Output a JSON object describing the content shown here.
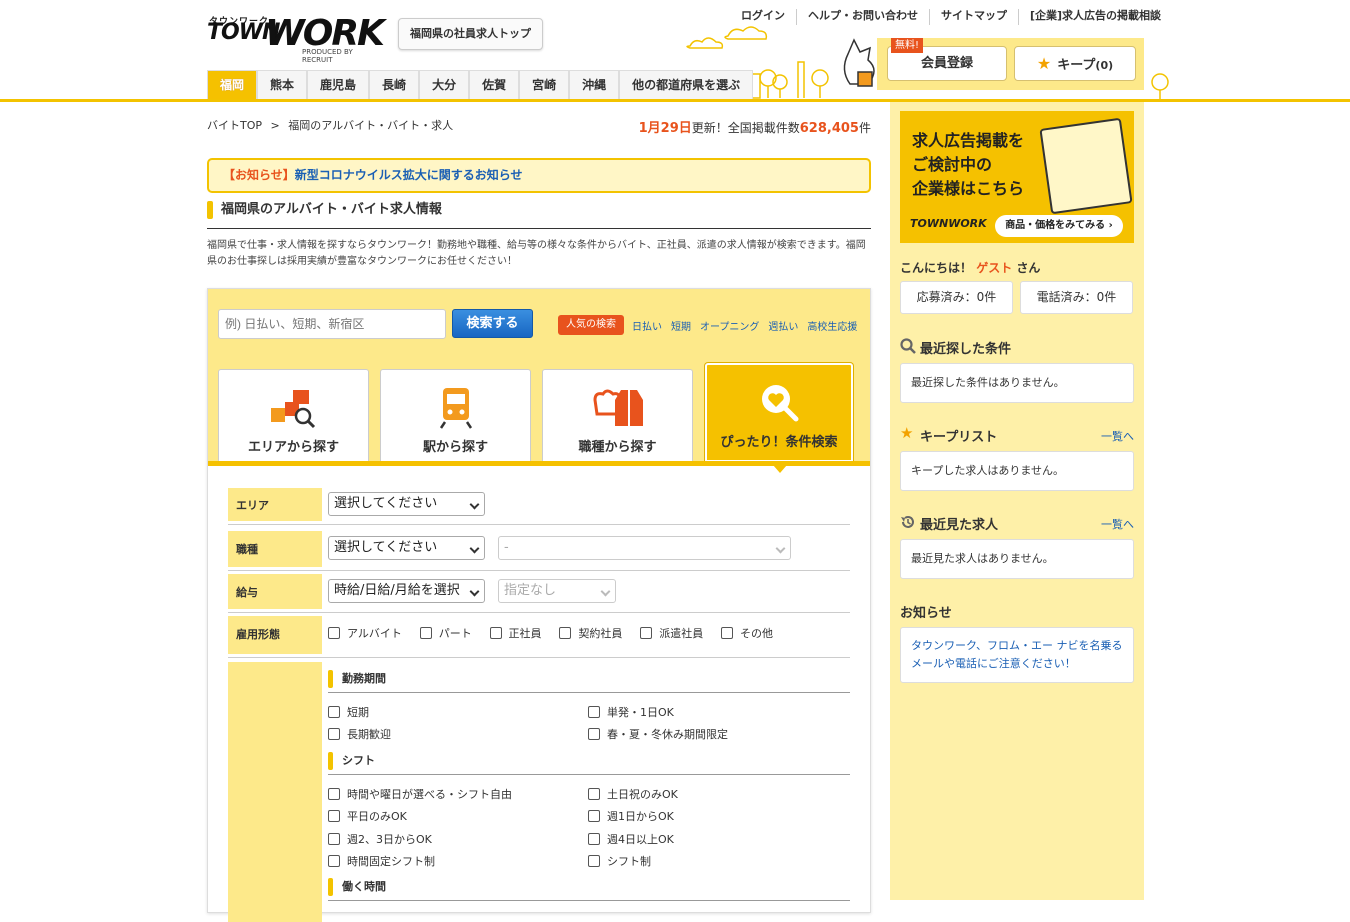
{
  "header": {
    "logo_kana": "タウンワーク",
    "logo_town": "TOWN",
    "logo_work": "WORK",
    "logo_produced": "PRODUCED BY RECRUIT",
    "top_button": "福岡県の社員求人トップ",
    "util_links": [
      "ログイン",
      "ヘルプ・お問い合わせ",
      "サイトマップ",
      "[企業]求人広告の掲載相談"
    ],
    "free_badge": "無料!",
    "register_label": "会員登録",
    "keep_label": "キープ",
    "keep_count": "(0)",
    "nav_tabs": [
      "福岡",
      "熊本",
      "鹿児島",
      "長崎",
      "大分",
      "佐賀",
      "宮崎",
      "沖縄",
      "他の都道府県を選ぶ"
    ]
  },
  "main": {
    "breadcrumb_top": "バイトTOP",
    "breadcrumb_sep": ">",
    "breadcrumb_current": "福岡のアルバイト・バイト・求人",
    "update_date": "1月29日",
    "update_text1": "更新！全国掲載件数",
    "update_count": "628,405",
    "update_unit": "件",
    "notice_label": "【お知らせ】",
    "notice_link": "新型コロナウイルス拡大に関するお知らせ",
    "section_title": "福岡県のアルバイト・バイト求人情報",
    "intro": "福岡県で仕事・求人情報を探すならタウンワーク！勤務地や職種、給与等の様々な条件からバイト、正社員、派遣の求人情報が検索できます。福岡県のお仕事探しは採用実績が豊富なタウンワークにお任せください！",
    "search": {
      "placeholder": "例) 日払い、短期、新宿区",
      "button": "検索する",
      "popular_tag": "人気の検索",
      "popular_links": [
        "日払い",
        "短期",
        "オープニング",
        "週払い",
        "高校生応援"
      ],
      "tabs": [
        "エリアから探す",
        "駅から探す",
        "職種から探す",
        "ぴったり！条件検索"
      ]
    },
    "form": {
      "area_label": "エリア",
      "area_value": "選択してください",
      "job_label": "職種",
      "job_value": "選択してください",
      "job_sub_value": "-",
      "pay_label": "給与",
      "pay_value": "時給/日給/月給を選択",
      "pay_sub_value": "指定なし",
      "emp_label": "雇用形態",
      "emp_options": [
        "アルバイト",
        "パート",
        "正社員",
        "契約社員",
        "派遣社員",
        "その他"
      ],
      "period_heading": "勤務期間",
      "period_options": [
        "短期",
        "単発・1日OK",
        "長期歓迎",
        "春・夏・冬休み期間限定"
      ],
      "shift_heading": "シフト",
      "shift_options": [
        "時間や曜日が選べる・シフト自由",
        "土日祝のみOK",
        "平日のみOK",
        "週1日からOK",
        "週2、3日からOK",
        "週4日以上OK",
        "時間固定シフト制",
        "シフト制"
      ],
      "hours_heading": "働く時間"
    }
  },
  "side": {
    "ad_title_lines": [
      "求人広告掲載を",
      "ご検討中の",
      "企業様はこちら"
    ],
    "ad_brand": "TOWNWORK",
    "ad_cta": "商品・価格をみてみる ›",
    "greet_prefix": "こんにちは！",
    "greet_name": "ゲスト",
    "greet_suffix": "さん",
    "applied": "応募済み：0件",
    "called": "電話済み：0件",
    "recent_search_heading": "最近探した条件",
    "recent_search_empty": "最近探した条件はありません。",
    "keep_heading": "キープリスト",
    "keep_link": "一覧へ",
    "keep_empty": "キープした求人はありません。",
    "recent_view_heading": "最近見た求人",
    "recent_view_link": "一覧へ",
    "recent_view_empty": "最近見た求人はありません。",
    "news_heading": "お知らせ",
    "news_link": "タウンワーク、フロム・エー ナビを名乗るメールや電話にご注意ください！"
  },
  "colors": {
    "brand_yellow": "#f5c100",
    "light_yellow": "#fde98a",
    "accent_orange": "#e8531d",
    "link_blue": "#1a5fb4"
  }
}
